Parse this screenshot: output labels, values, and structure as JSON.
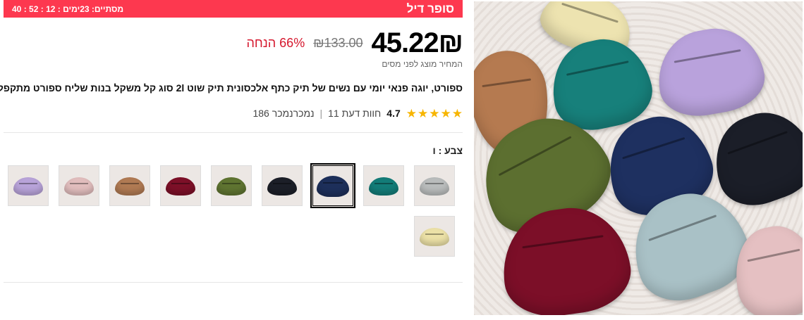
{
  "promo": {
    "title": "סופר דיל",
    "timer": "מסתיים: 23ימים : 12 : 52 : 40"
  },
  "price": {
    "current": "45.22₪",
    "original": "₪133.00",
    "discount": "66% הנחה",
    "tax_note": "המחיר מוצג לפני מסים"
  },
  "product": {
    "title": "ספורט, יוגה פנאי יומי עם נשים של תיק כתף אלכסונית תיק שוט 2l סוג קל משקל בנות שליח ספורט מתקפל"
  },
  "rating": {
    "value": "4.7",
    "stars": 5,
    "reviews": "11 חוות דעת",
    "sold": "186 נמכרנמכר"
  },
  "color": {
    "label": "צבע : ו",
    "selected_index": 2,
    "swatches": [
      {
        "name": "light-gray",
        "color": "#b9bcbc"
      },
      {
        "name": "teal",
        "color": "#137c78"
      },
      {
        "name": "navy",
        "color": "#1d2f5a"
      },
      {
        "name": "black",
        "color": "#1c1f28"
      },
      {
        "name": "olive",
        "color": "#5f7431"
      },
      {
        "name": "burgundy",
        "color": "#7d1028"
      },
      {
        "name": "tan",
        "color": "#b07a53"
      },
      {
        "name": "pink",
        "color": "#e1bdbd"
      },
      {
        "name": "lavender",
        "color": "#b8a3d9"
      },
      {
        "name": "cream",
        "color": "#ece1a7"
      }
    ]
  },
  "colors": {
    "promo_bg": "#fd384f",
    "discount_red": "#d5172d",
    "star_gold": "#f7b500"
  }
}
